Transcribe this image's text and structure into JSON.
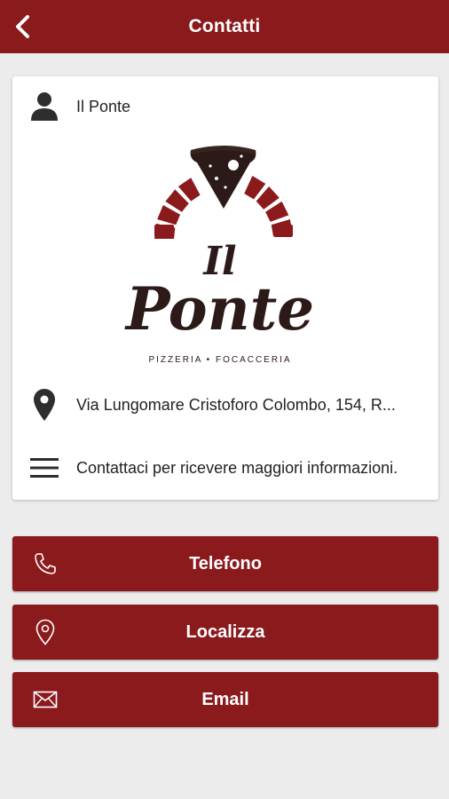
{
  "header": {
    "title": "Contatti",
    "back_icon": "chevron-left-icon",
    "background": "#8b1a1d"
  },
  "card": {
    "name": {
      "icon": "person-icon",
      "label": "Il Ponte"
    },
    "logo": {
      "line1": "Il",
      "line2": "Ponte",
      "tagline": "PIZZERIA • FOCACCERIA"
    },
    "address": {
      "icon": "map-pin-icon",
      "label": "Via Lungomare Cristoforo Colombo, 154, R..."
    },
    "description": {
      "icon": "menu-lines-icon",
      "label": "Contattaci per ricevere maggiori informazioni."
    }
  },
  "buttons": [
    {
      "icon": "phone-icon",
      "label": "Telefono"
    },
    {
      "icon": "location-pin-icon",
      "label": "Localizza"
    },
    {
      "icon": "envelope-icon",
      "label": "Email"
    }
  ],
  "colors": {
    "accent": "#8b1a1d",
    "background": "#ececec",
    "card": "#ffffff",
    "logo_dark": "#2b1a17"
  }
}
